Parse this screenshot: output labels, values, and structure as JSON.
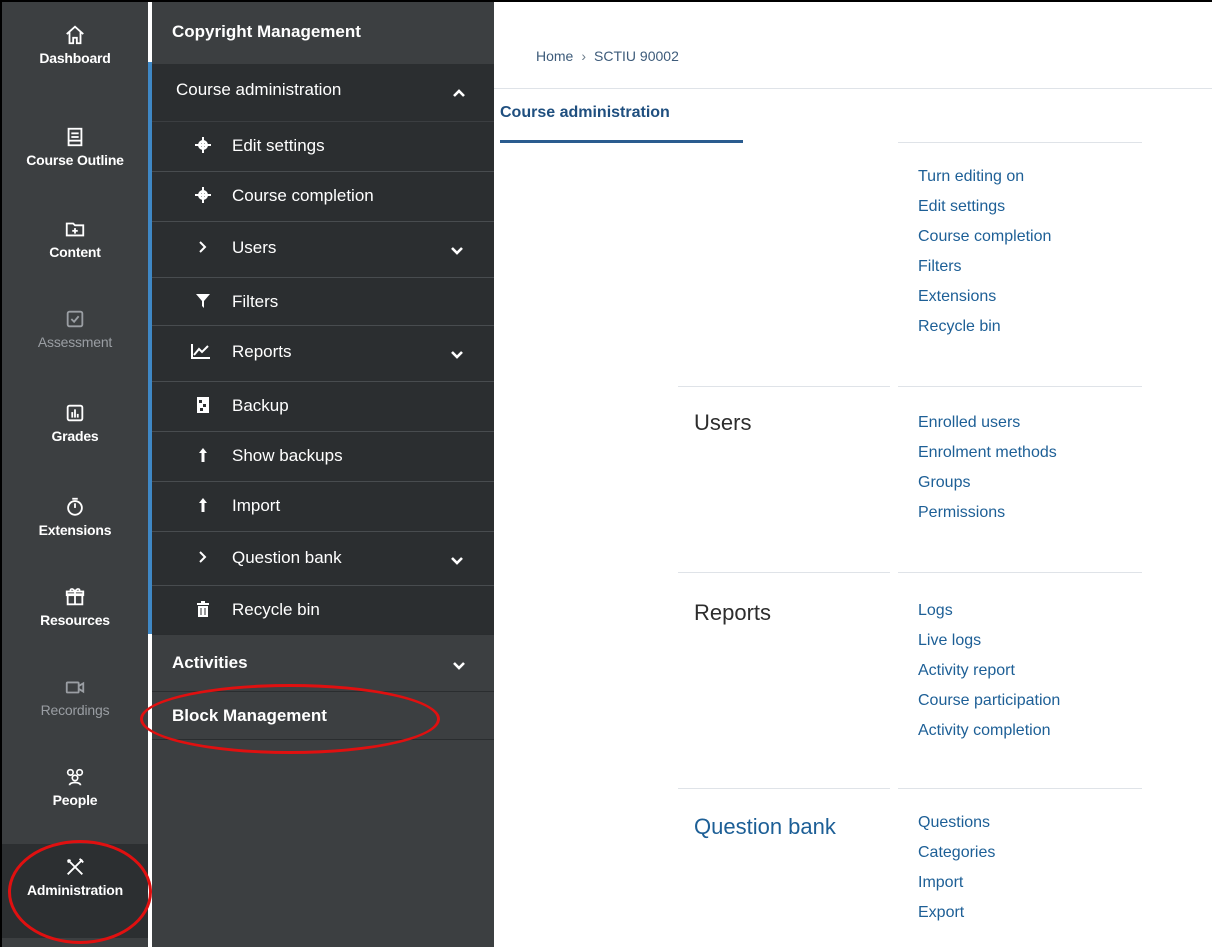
{
  "rail": {
    "items": [
      {
        "label": "Dashboard",
        "icon": "home-icon"
      },
      {
        "label": "Course Outline",
        "icon": "document-icon"
      },
      {
        "label": "Content",
        "icon": "folder-plus-icon"
      },
      {
        "label": "Assessment",
        "icon": "checkbox-icon"
      },
      {
        "label": "Grades",
        "icon": "bar-chart-icon"
      },
      {
        "label": "Extensions",
        "icon": "stopwatch-icon"
      },
      {
        "label": "Resources",
        "icon": "gift-icon"
      },
      {
        "label": "Recordings",
        "icon": "video-camera-icon"
      },
      {
        "label": "People",
        "icon": "people-icon"
      },
      {
        "label": "Administration",
        "icon": "tools-icon"
      }
    ]
  },
  "drawer": {
    "header": "Copyright Management",
    "section_title": "Course administration",
    "items": [
      {
        "label": "Edit settings",
        "icon": "gear-icon"
      },
      {
        "label": "Course completion",
        "icon": "gear-icon"
      },
      {
        "label": "Users",
        "icon": "chevron-right-icon"
      },
      {
        "label": "Filters",
        "icon": "filter-icon"
      },
      {
        "label": "Reports",
        "icon": "line-chart-icon"
      },
      {
        "label": "Backup",
        "icon": "file-icon"
      },
      {
        "label": "Show backups",
        "icon": "upload-icon"
      },
      {
        "label": "Import",
        "icon": "upload-icon"
      },
      {
        "label": "Question bank",
        "icon": "chevron-right-icon"
      },
      {
        "label": "Recycle bin",
        "icon": "trash-icon"
      }
    ],
    "activities": "Activities",
    "block_management": "Block Management"
  },
  "breadcrumb": {
    "home": "Home",
    "sep": "›",
    "course": "SCTIU 90002"
  },
  "tab": {
    "label": "Course administration"
  },
  "groups": {
    "course": {
      "links": [
        "Turn editing on",
        "Edit settings",
        "Course completion",
        "Filters",
        "Extensions",
        "Recycle bin"
      ]
    },
    "users": {
      "title": "Users",
      "links": [
        "Enrolled users",
        "Enrolment methods",
        "Groups",
        "Permissions"
      ]
    },
    "reports": {
      "title": "Reports",
      "links": [
        "Logs",
        "Live logs",
        "Activity report",
        "Course participation",
        "Activity completion"
      ]
    },
    "question_bank": {
      "title": "Question bank",
      "links": [
        "Questions",
        "Categories",
        "Import",
        "Export"
      ]
    }
  },
  "colors": {
    "rail_bg": "#3c3f41",
    "drawer_open_bg": "#2b2e30",
    "accent": "#3f88c5",
    "link": "#1d5f96",
    "highlight_ring": "#e01010"
  }
}
